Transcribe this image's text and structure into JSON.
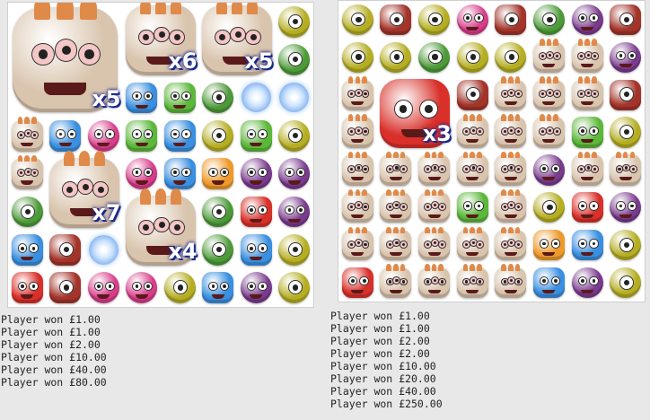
{
  "symbols": {
    "stone": {
      "color": "#d9c4ad",
      "eye": "#e05a5a",
      "shape": "square"
    },
    "blue": {
      "color": "#3a8fe0",
      "shape": "square"
    },
    "pink": {
      "color": "#d83c8a",
      "shape": "round"
    },
    "green": {
      "color": "#5cb83a",
      "shape": "square"
    },
    "olive": {
      "color": "#b5ae22",
      "shape": "round"
    },
    "purple": {
      "color": "#7a3a8e",
      "shape": "round"
    },
    "red": {
      "color": "#d9302a",
      "shape": "square"
    },
    "orange": {
      "color": "#ee9a2a",
      "shape": "square"
    },
    "maroon": {
      "color": "#a3342a",
      "shape": "square"
    },
    "slime": {
      "color": "#4c9a38",
      "shape": "round"
    },
    "orb": {
      "color": "#9cc7ff",
      "shape": "orb"
    }
  },
  "left_board": {
    "grid": [
      [
        "stone",
        "stone",
        "stone",
        "stone",
        "stone",
        "stone",
        "stone",
        "olive"
      ],
      [
        "stone",
        "stone",
        "stone",
        "stone",
        "stone",
        "stone",
        "stone",
        "slime"
      ],
      [
        "stone",
        "stone",
        "olive",
        "blue",
        "green",
        "slime",
        "orb",
        "orb"
      ],
      [
        "stone",
        "blue",
        "pink",
        "green",
        "blue",
        "olive",
        "green",
        "olive"
      ],
      [
        "stone",
        "stone",
        "stone",
        "pink",
        "blue",
        "orange",
        "purple",
        "purple"
      ],
      [
        "slime",
        "stone",
        "stone",
        "stone",
        "stone",
        "slime",
        "red",
        "purple"
      ],
      [
        "blue",
        "maroon",
        "orb",
        "stone",
        "stone",
        "slime",
        "blue",
        "olive"
      ],
      [
        "red",
        "maroon",
        "pink",
        "pink",
        "olive",
        "blue",
        "purple",
        "olive"
      ]
    ],
    "big_symbols": [
      {
        "row": 0,
        "col": 0,
        "span": 3,
        "multiplier": "x5"
      },
      {
        "row": 0,
        "col": 3,
        "span": 2,
        "multiplier": "x6"
      },
      {
        "row": 0,
        "col": 5,
        "span": 2,
        "multiplier": "x5"
      },
      {
        "row": 4,
        "col": 1,
        "span": 2,
        "multiplier": "x7"
      },
      {
        "row": 5,
        "col": 3,
        "span": 2,
        "multiplier": "x4"
      }
    ]
  },
  "right_board": {
    "grid": [
      [
        "olive",
        "maroon",
        "olive",
        "pink",
        "maroon",
        "slime",
        "purple",
        "maroon"
      ],
      [
        "olive",
        "olive",
        "slime",
        "olive",
        "olive",
        "stone",
        "stone",
        "purple"
      ],
      [
        "stone",
        "red",
        "red",
        "maroon",
        "stone",
        "stone",
        "stone",
        "maroon"
      ],
      [
        "stone",
        "red",
        "red",
        "stone",
        "stone",
        "stone",
        "green",
        "olive"
      ],
      [
        "stone",
        "stone",
        "stone",
        "stone",
        "stone",
        "purple",
        "stone",
        "stone"
      ],
      [
        "stone",
        "stone",
        "stone",
        "green",
        "stone",
        "olive",
        "red",
        "purple"
      ],
      [
        "stone",
        "stone",
        "stone",
        "stone",
        "stone",
        "orange",
        "blue",
        "olive"
      ],
      [
        "red",
        "stone",
        "stone",
        "stone",
        "stone",
        "blue",
        "purple",
        "olive"
      ]
    ],
    "big_symbols": [
      {
        "row": 2,
        "col": 1,
        "span": 2,
        "multiplier": "x3"
      }
    ]
  },
  "log_left": [
    "Player won £1.00",
    "Player won £1.00",
    "Player won £2.00",
    "Player won £10.00",
    "Player won £40.00",
    "Player won £80.00"
  ],
  "log_right": [
    "Player won £1.00",
    "Player won £1.00",
    "Player won £2.00",
    "Player won £2.00",
    "Player won £10.00",
    "Player won £20.00",
    "Player won £40.00",
    "Player won £250.00"
  ]
}
